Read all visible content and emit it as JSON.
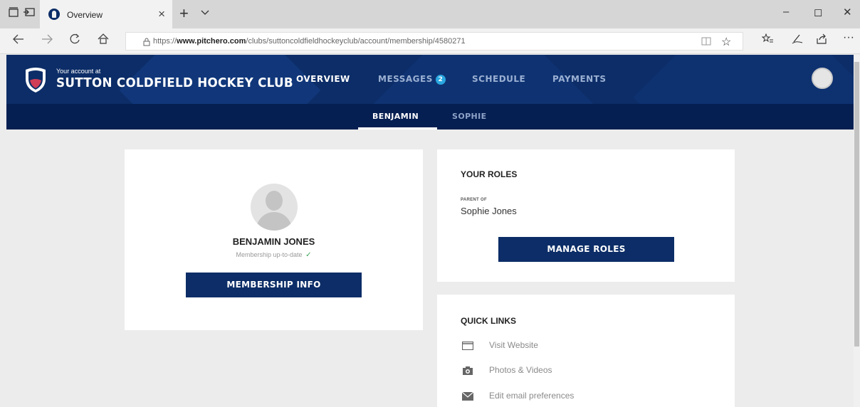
{
  "browser": {
    "tab_title": "Overview",
    "tab_close": "×",
    "new_tab": "+",
    "url_prefix": "https://",
    "url_domain": "www.pitchero.com",
    "url_path": "/clubs/suttoncoldfieldhockeyclub/account/membership/4580271",
    "icons": [
      "tab-list-icon",
      "set-aside-icon",
      "back-icon",
      "forward-icon",
      "refresh-icon",
      "home-icon",
      "lock-icon",
      "reading-view-icon",
      "favorite-star-icon",
      "favorites-bar-icon",
      "pen-icon",
      "share-icon",
      "more-icon"
    ],
    "window_controls": {
      "minimize": "–",
      "maximize": "◻",
      "close": "✕"
    }
  },
  "header": {
    "account_label": "Your account at",
    "club_name": "SUTTON COLDFIELD HOCKEY CLUB",
    "nav": {
      "overview": "OVERVIEW",
      "messages": "MESSAGES",
      "messages_count": "2",
      "schedule": "SCHEDULE",
      "payments": "PAYMENTS"
    },
    "colors": {
      "primary": "#0c2d67",
      "subnav": "#061f52",
      "badge": "#2aa7e0"
    }
  },
  "subnav": {
    "tabs": [
      "BENJAMIN",
      "SOPHIE"
    ],
    "active": "BENJAMIN"
  },
  "profile": {
    "name": "BENJAMIN JONES",
    "status": "Membership up-to-date",
    "status_icon": "✓",
    "button": "MEMBERSHIP INFO"
  },
  "roles": {
    "heading": "YOUR ROLES",
    "role_label": "PARENT OF",
    "child_name": "Sophie Jones",
    "button": "MANAGE ROLES"
  },
  "quick_links": {
    "heading": "QUICK LINKS",
    "items": [
      {
        "label": "Visit Website",
        "icon": "website-icon"
      },
      {
        "label": "Photos & Videos",
        "icon": "camera-icon"
      },
      {
        "label": "Edit email preferences",
        "icon": "envelope-icon"
      }
    ]
  }
}
